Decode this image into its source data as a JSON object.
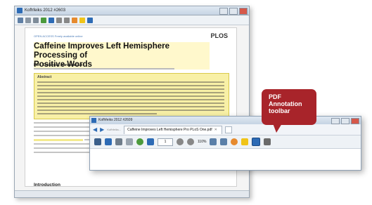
{
  "colors": {
    "accent": "#2d6bb5",
    "callout_bg": "#a8242a",
    "highlight": "#f8f0a6",
    "icon_orange": "#e68a2e",
    "icon_green": "#4c9a3c",
    "icon_yellow": "#f0c419"
  },
  "background_window": {
    "title": "Kofhfeiks 2012 #2603",
    "journal_tag": "OPEN ACCESS Freely available online",
    "publisher_logo": "PLOS",
    "paper": {
      "title_line1": "Caffeine Improves Left Hemisphere Processing of",
      "title_line2": "Positive Words",
      "authors": "Lars Kuchinke*, Vanessa Lux",
      "abstract_heading": "Abstract",
      "intro_heading": "Introduction"
    }
  },
  "foreground_window": {
    "title": "Kofhfeiks 2012 #2609",
    "breadcrumb": "Kofhfeiks...",
    "tab_label": "Caffeine Improves Left Hemisphere Pro PLoS One.pdf",
    "page_value": "1",
    "zoom_value": "110%",
    "icons": [
      "back-icon",
      "forward-icon",
      "save-icon",
      "print-icon",
      "email-icon",
      "search-icon",
      "pointer-icon",
      "highlight-icon",
      "down-icon",
      "zoom-out-icon",
      "zoom-in-icon",
      "undo-icon",
      "redo-icon",
      "sticky-note-icon",
      "text-icon",
      "strike-icon"
    ]
  },
  "callout": {
    "line1": "PDF",
    "line2": "Annotation",
    "line3": "toolbar"
  }
}
